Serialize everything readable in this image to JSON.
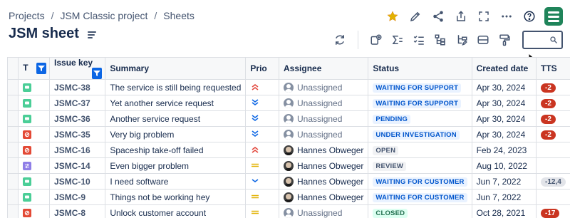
{
  "breadcrumb": {
    "items": [
      "Projects",
      "JSM Classic project",
      "Sheets"
    ],
    "separator": "/"
  },
  "page": {
    "title": "JSM sheet"
  },
  "top_icons": [
    "star-icon",
    "edit-icon",
    "share-icon",
    "export-icon",
    "fullscreen-icon",
    "more-icon",
    "help-icon",
    "app-logo"
  ],
  "toolbar": {
    "icons": [
      "refresh-icon",
      "add-field-icon",
      "sum-icon",
      "checklist-icon",
      "hierarchy-icon",
      "hierarchy-edit-icon",
      "layout-icon",
      "format-paint-icon"
    ],
    "search": {
      "placeholder": "",
      "value": ""
    }
  },
  "colors": {
    "accent": "#0c66e4",
    "star": "#e2b203",
    "logo": "#1f845a",
    "tts_red": "#ca3521"
  },
  "table": {
    "columns": [
      "T",
      "Issue key",
      "Summary",
      "Prio",
      "Assignee",
      "Status",
      "Created date",
      "TTS"
    ],
    "rows": [
      {
        "type": "service-request",
        "type_color": "#4bce97",
        "key": "JSMC-38",
        "summary": "The service is still being requested",
        "prio": "highest",
        "assignee": "Unassigned",
        "status": "WAITING FOR SUPPORT",
        "status_tone": "blue",
        "created": "Apr 30, 2024",
        "tts": "-2",
        "tts_tone": "red"
      },
      {
        "type": "service-request",
        "type_color": "#4bce97",
        "key": "JSMC-37",
        "summary": "Yet another service request",
        "prio": "lowest",
        "assignee": "Unassigned",
        "status": "WAITING FOR SUPPORT",
        "status_tone": "blue",
        "created": "Apr 30, 2024",
        "tts": "-2",
        "tts_tone": "red"
      },
      {
        "type": "service-request",
        "type_color": "#4bce97",
        "key": "JSMC-36",
        "summary": "Another service request",
        "prio": "lowest",
        "assignee": "Unassigned",
        "status": "PENDING",
        "status_tone": "blue",
        "created": "Apr 30, 2024",
        "tts": "-2",
        "tts_tone": "red"
      },
      {
        "type": "incident",
        "type_color": "#e34935",
        "key": "JSMC-35",
        "summary": "Very big problem",
        "prio": "lowest",
        "assignee": "Unassigned",
        "status": "UNDER INVESTIGATION",
        "status_tone": "blue",
        "created": "Apr 30, 2024",
        "tts": "-2",
        "tts_tone": "red"
      },
      {
        "type": "incident",
        "type_color": "#e34935",
        "key": "JSMC-16",
        "summary": "Spaceship take-off failed",
        "prio": "highest",
        "assignee": "Hannes Obweger",
        "status": "OPEN",
        "status_tone": "grey",
        "created": "Feb 24, 2023",
        "tts": "",
        "tts_tone": "none"
      },
      {
        "type": "change",
        "type_color": "#8f7ee7",
        "key": "JSMC-14",
        "summary": "Even bigger problem",
        "prio": "medium",
        "assignee": "Hannes Obweger",
        "status": "REVIEW",
        "status_tone": "grey",
        "created": "Aug 10, 2022",
        "tts": "",
        "tts_tone": "none"
      },
      {
        "type": "service-request",
        "type_color": "#4bce97",
        "key": "JSMC-10",
        "summary": "I need software",
        "prio": "low",
        "assignee": "Hannes Obweger",
        "status": "WAITING FOR CUSTOMER",
        "status_tone": "blue",
        "created": "Jun 7, 2022",
        "tts": "-12,4",
        "tts_tone": "grey"
      },
      {
        "type": "service-request",
        "type_color": "#4bce97",
        "key": "JSMC-9",
        "summary": "Things not be working hey",
        "prio": "medium",
        "assignee": "Hannes Obweger",
        "status": "WAITING FOR CUSTOMER",
        "status_tone": "blue",
        "created": "Jun 7, 2022",
        "tts": "",
        "tts_tone": "none"
      },
      {
        "type": "incident",
        "type_color": "#e34935",
        "key": "JSMC-8",
        "summary": "Unlock customer account",
        "prio": "medium",
        "assignee": "Unassigned",
        "status": "CLOSED",
        "status_tone": "green",
        "created": "Oct 28, 2021",
        "tts": "-17",
        "tts_tone": "red"
      }
    ]
  }
}
